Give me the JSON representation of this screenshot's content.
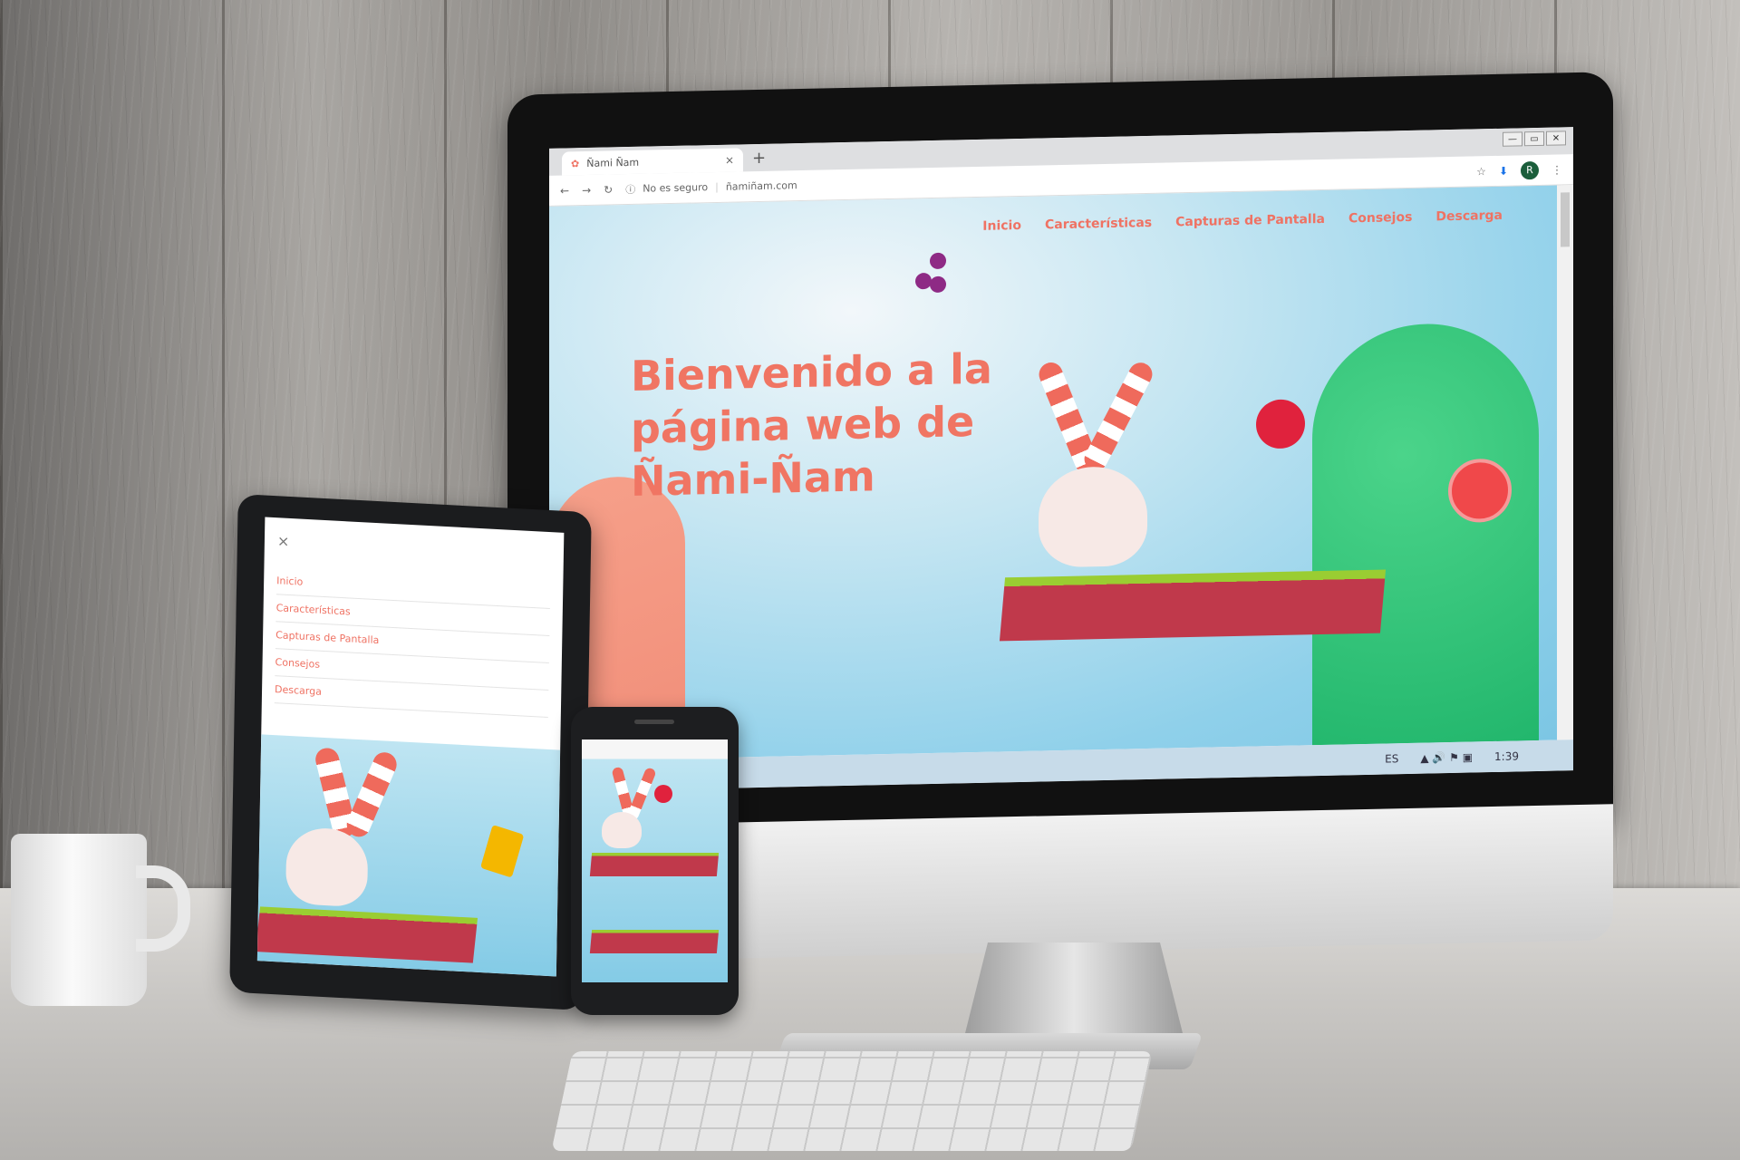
{
  "browser": {
    "tab_title": "Ñami Ñam",
    "tab_close": "×",
    "new_tab": "+",
    "security_label": "No es seguro",
    "url": "ñamiñam.com",
    "avatar_letter": "R",
    "window_controls": [
      "—",
      "▭",
      "✕"
    ]
  },
  "site": {
    "nav": [
      "Inicio",
      "Características",
      "Capturas de Pantalla",
      "Consejos",
      "Descarga"
    ],
    "hero_title": "Bienvenido a la página web de Ñami-Ñam",
    "accent_color": "#f07563"
  },
  "taskbar": {
    "language": "ES",
    "time": "1:39"
  },
  "tablet_menu": {
    "close": "×",
    "items": [
      "Inicio",
      "Características",
      "Capturas de Pantalla",
      "Consejos",
      "Descarga"
    ]
  },
  "icons": [
    "back-arrow-icon",
    "forward-arrow-icon",
    "reload-icon",
    "info-icon",
    "star-icon",
    "extension-icon",
    "menu-dots-icon"
  ]
}
